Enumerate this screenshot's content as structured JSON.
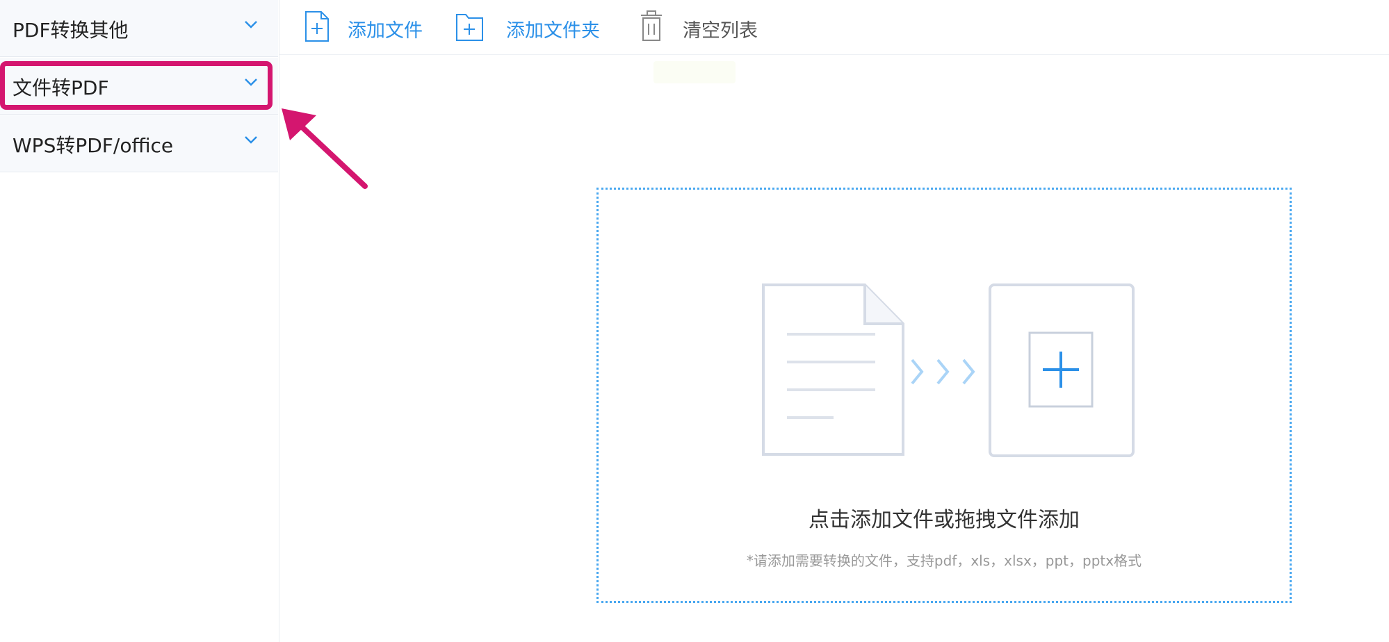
{
  "sidebar": {
    "items": [
      {
        "label": "PDF转换其他"
      },
      {
        "label": "文件转PDF",
        "highlighted": true
      },
      {
        "label": "WPS转PDF/office"
      }
    ]
  },
  "toolbar": {
    "add_file_label": "添加文件",
    "add_folder_label": "添加文件夹",
    "clear_list_label": "清空列表"
  },
  "drop_zone": {
    "title": "点击添加文件或拖拽文件添加",
    "hint": "*请添加需要转换的文件，支持pdf，xls，xlsx，ppt，pptx格式"
  },
  "colors": {
    "accent": "#2b90e8",
    "highlight": "#d4166f",
    "sidebar_bg": "#f7f9fc",
    "drop_border": "#4aa8f0"
  },
  "icons": [
    "chevron-down-icon",
    "add-file-icon",
    "add-folder-icon",
    "trash-icon",
    "pointer-arrow",
    "document-icon",
    "arrows-icon",
    "add-box-icon"
  ]
}
